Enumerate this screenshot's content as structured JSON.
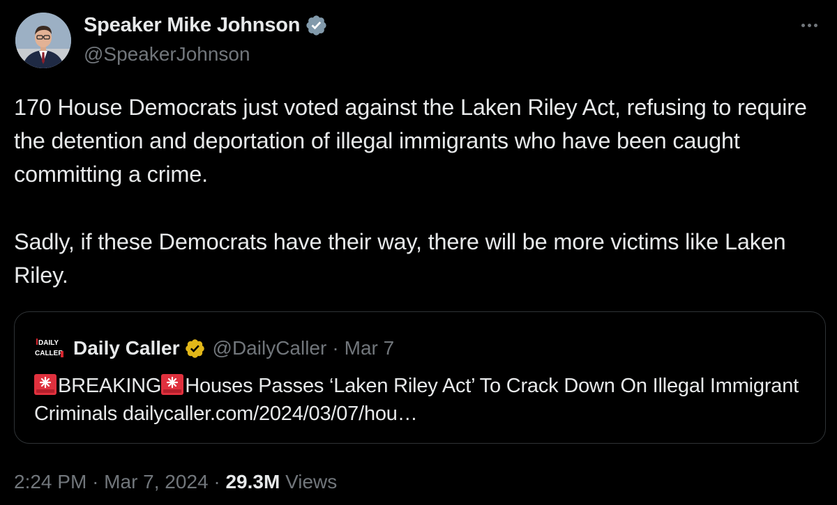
{
  "author": {
    "display_name": "Speaker Mike Johnson",
    "handle": "@SpeakerJohnson",
    "verified_icon": "verified-badge-gray"
  },
  "tweet": {
    "paragraph_1": "170 House Democrats just voted against the Laken Riley Act, refusing to require the detention and deportation of illegal immigrants who have been caught committing a crime.",
    "paragraph_2": "Sadly, if these Democrats have their way, there will be more victims like Laken Riley."
  },
  "quote": {
    "display_name": "Daily Caller",
    "handle": "@DailyCaller",
    "separator": "·",
    "date": "Mar 7",
    "logo_text": "DAILY CALLER",
    "text_breaking": "BREAKING",
    "text_rest": "Houses Passes ‘Laken Riley Act’ To Crack Down On Illegal Immigrant Criminals dailycaller.com/2024/03/07/hou…",
    "badge_icon": "verified-badge-gold",
    "emoji": "police-siren-icon"
  },
  "meta": {
    "time": "2:24 PM",
    "separator": "·",
    "date": "Mar 7, 2024",
    "views_count": "29.3M",
    "views_label": "Views"
  },
  "colors": {
    "background": "#000000",
    "text": "#e7e9ea",
    "secondary": "#71767b",
    "border": "#2f3336",
    "siren_red": "#e0313e"
  }
}
